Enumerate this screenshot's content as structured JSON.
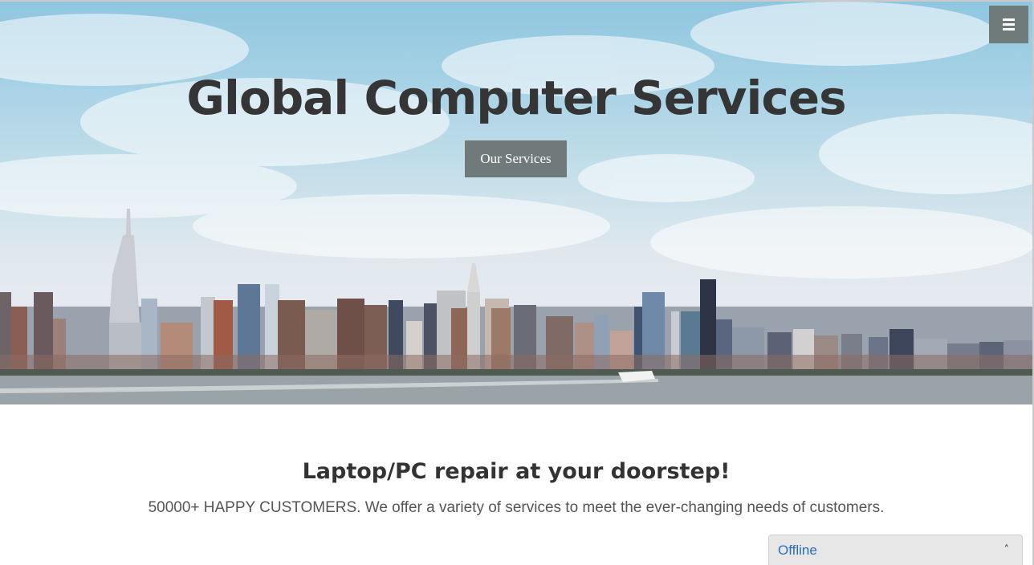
{
  "hero": {
    "title": "Global Computer Services",
    "button_label": "Our Services"
  },
  "header": {
    "menu_icon": "hamburger-icon"
  },
  "intro": {
    "heading": "Laptop/PC repair at your doorstep!",
    "text": "50000+ HAPPY CUSTOMERS. We offer a variety of services to meet the ever-changing needs of customers."
  },
  "chat": {
    "status": "Offline",
    "icon": "chevron-up-icon"
  },
  "colors": {
    "button_bg": "#707a7a",
    "chat_status": "#2a6fb6",
    "title": "#353535"
  }
}
